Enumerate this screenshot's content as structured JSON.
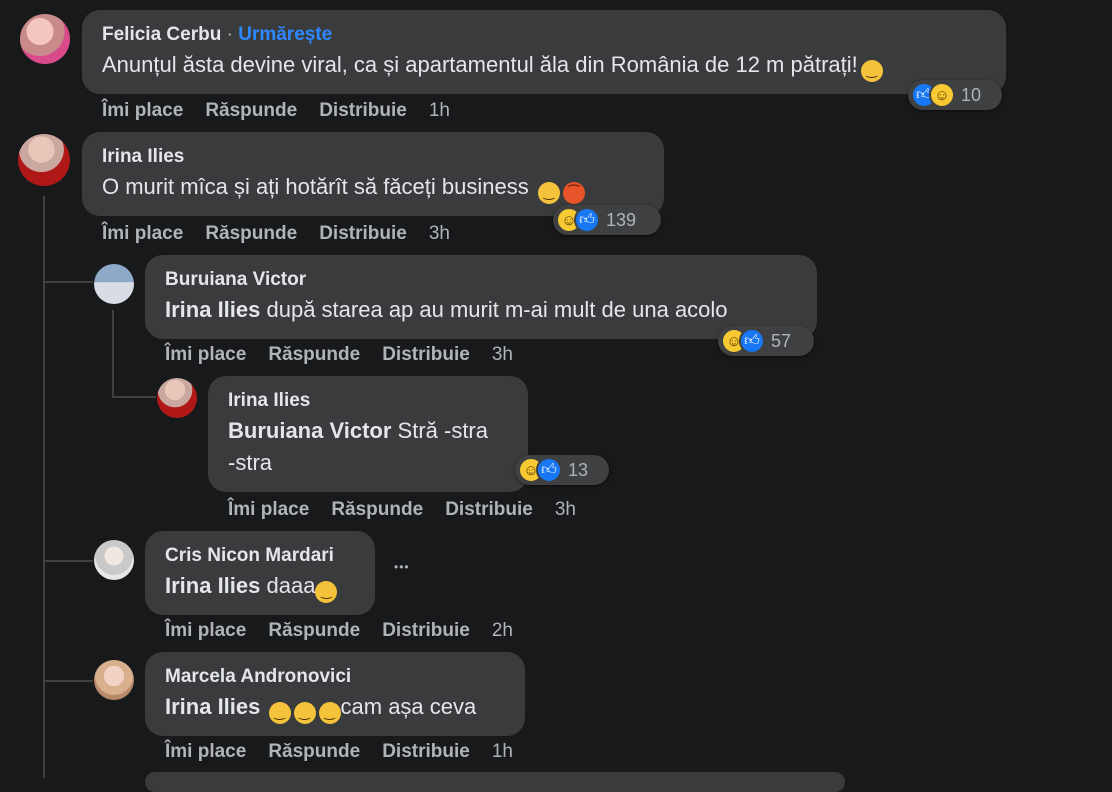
{
  "actions": {
    "like": "Îmi place",
    "reply": "Răspunde",
    "share": "Distribuie"
  },
  "comments": [
    {
      "author": "Felicia Cerbu",
      "separator": "·",
      "follow": "Urmărește",
      "text": "Anunțul ăsta devine viral, ca și apartamentul ăla din România de 12 m pătrați!",
      "time": "1h",
      "reaction_count": "10",
      "reactions": [
        "like-icon",
        "haha-icon"
      ],
      "inline_emoji": [
        "grin-emoji"
      ]
    },
    {
      "author": "Irina Ilies",
      "text": "O murit mîca și ați hotărît să fǎceți business",
      "time": "3h",
      "reaction_count": "139",
      "reactions": [
        "haha-icon",
        "like-icon"
      ],
      "inline_emoji": [
        "upside-down-face-emoji",
        "angry-face-emoji"
      ]
    },
    {
      "author": "Buruiana Victor",
      "mention": "Irina Ilies",
      "text": " după starea ap au murit m-ai mult de una acolo",
      "time": "3h",
      "reaction_count": "57",
      "reactions": [
        "haha-icon",
        "like-icon"
      ]
    },
    {
      "author": "Irina Ilies",
      "mention": "Buruiana Victor",
      "text_line1": " Stră -stra",
      "text_line2": "-stra",
      "time": "3h",
      "reaction_count": "13",
      "reactions": [
        "haha-icon",
        "like-icon"
      ]
    },
    {
      "author": "Cris Nicon Mardari",
      "mention": "Irina Ilies",
      "text": " daaa",
      "time": "2h",
      "inline_emoji": [
        "tears-of-joy-emoji"
      ],
      "more": "•••"
    },
    {
      "author": "Marcela Andronovici",
      "mention": "Irina Ilies",
      "text": "cam așa ceva",
      "time": "1h",
      "inline_emoji": [
        "rofl-emoji",
        "rofl-emoji",
        "rofl-emoji"
      ]
    }
  ],
  "colors": {
    "background": "#18191a",
    "bubble": "#3a3b3c",
    "link": "#2d88ff",
    "secondary_text": "#b0b3b8",
    "like_blue": "#1877f2",
    "haha_yellow": "#f7c933"
  }
}
